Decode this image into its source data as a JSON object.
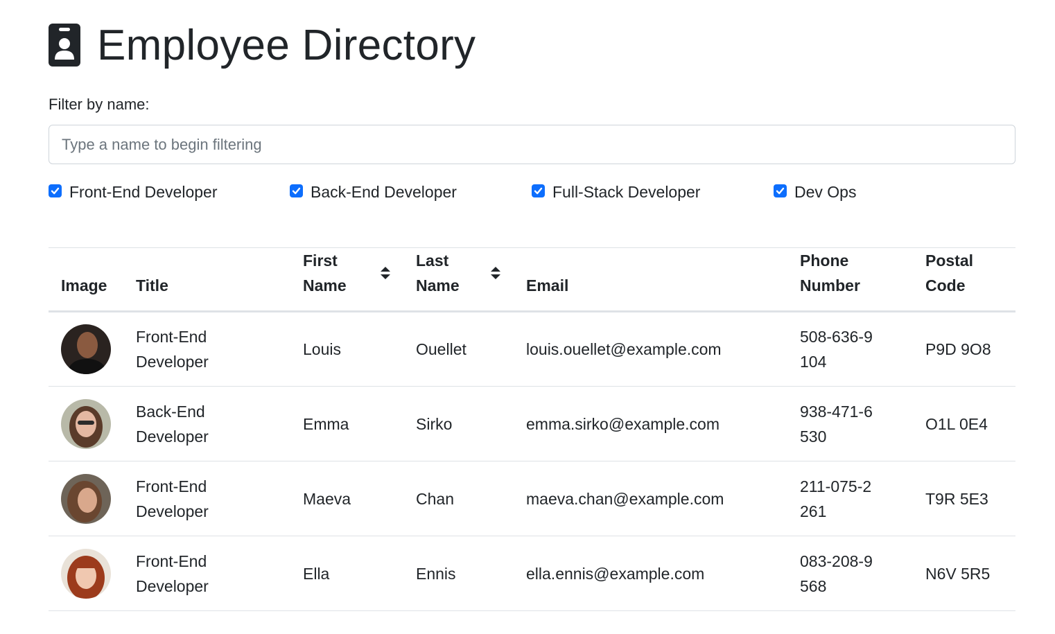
{
  "page": {
    "title": "Employee Directory",
    "title_icon": "id-badge-icon"
  },
  "filter": {
    "label": "Filter by name:",
    "placeholder": "Type a name to begin filtering",
    "value": ""
  },
  "roles": [
    {
      "label": "Front-End Developer",
      "checked": true
    },
    {
      "label": "Back-End Developer",
      "checked": true
    },
    {
      "label": "Full-Stack Developer",
      "checked": true
    },
    {
      "label": "Dev Ops",
      "checked": true
    }
  ],
  "table": {
    "headers": {
      "image": "Image",
      "title": "Title",
      "first_name": "First Name",
      "last_name": "Last Name",
      "email": "Email",
      "phone": "Phone Number",
      "postal": "Postal Code"
    },
    "sort_icons": [
      "sort-icon",
      "sort-icon"
    ],
    "rows": [
      {
        "avatar": "avatar-photo",
        "title": "Front-End Developer",
        "first": "Louis",
        "last": "Ouellet",
        "email": "louis.ouellet@example.com",
        "phone": "508-636-9104",
        "postal": "P9D 9O8"
      },
      {
        "avatar": "avatar-photo",
        "title": "Back-End Developer",
        "first": "Emma",
        "last": "Sirko",
        "email": "emma.sirko@example.com",
        "phone": "938-471-6530",
        "postal": "O1L 0E4"
      },
      {
        "avatar": "avatar-photo",
        "title": "Front-End Developer",
        "first": "Maeva",
        "last": "Chan",
        "email": "maeva.chan@example.com",
        "phone": "211-075-2261",
        "postal": "T9R 5E3"
      },
      {
        "avatar": "avatar-photo",
        "title": "Front-End Developer",
        "first": "Ella",
        "last": "Ennis",
        "email": "ella.ennis@example.com",
        "phone": "083-208-9568",
        "postal": "N6V 5R5"
      }
    ]
  },
  "colors": {
    "checkbox": "#0d6efd",
    "text": "#212529",
    "border": "#dee2e6"
  }
}
